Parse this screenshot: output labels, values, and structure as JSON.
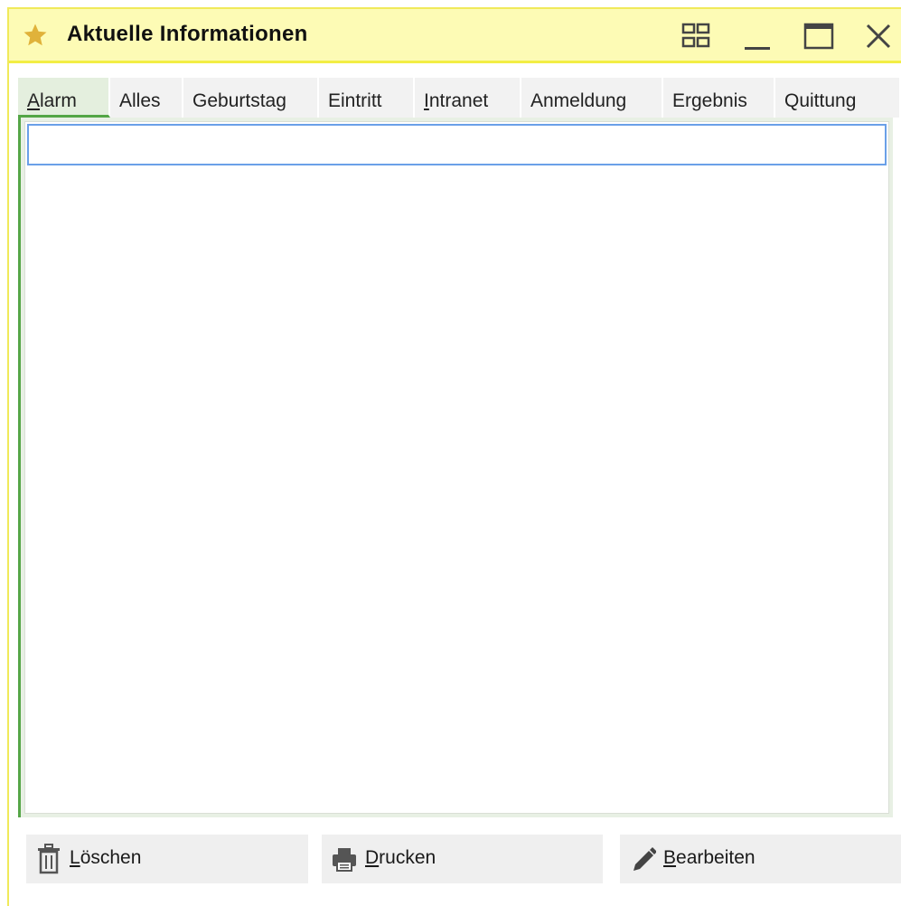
{
  "window": {
    "title": "Aktuelle Informationen",
    "icons": [
      "star-icon",
      "layout-grid-icon",
      "minimize-icon",
      "maximize-icon",
      "close-icon"
    ]
  },
  "tabs": [
    {
      "access_key": "A",
      "rest": "larm",
      "active": true
    },
    {
      "access_key": "",
      "rest": "Alles",
      "active": false
    },
    {
      "access_key": "",
      "rest": "Geburtstag",
      "active": false
    },
    {
      "access_key": "",
      "rest": "Eintritt",
      "active": false
    },
    {
      "access_key": "I",
      "rest": "ntranet",
      "active": false
    },
    {
      "access_key": "",
      "rest": "Anmeldung",
      "active": false
    },
    {
      "access_key": "",
      "rest": "Ergebnis",
      "active": false
    },
    {
      "access_key": "",
      "rest": "Quittung",
      "active": false
    }
  ],
  "buttons": {
    "delete": {
      "access_key": "L",
      "rest": "öschen",
      "icon": "trash-icon"
    },
    "print": {
      "access_key": "D",
      "rest": "rucken",
      "icon": "printer-icon"
    },
    "edit": {
      "access_key": "B",
      "rest": "earbeiten",
      "icon": "pencil-icon"
    }
  },
  "colors": {
    "titlebar_bg": "#fdfbb5",
    "titlebar_border": "#f3ee44",
    "accent_green": "#53a645",
    "selection_blue": "#6aa0e8",
    "star": "#e0b23a"
  }
}
